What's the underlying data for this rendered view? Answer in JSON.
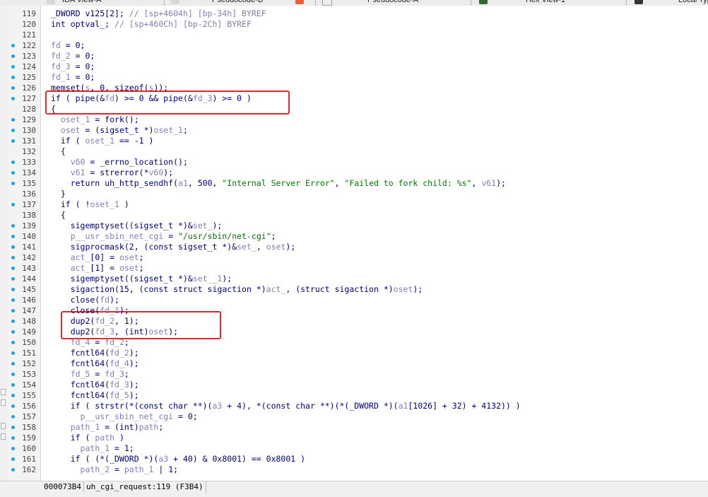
{
  "tabs": [
    {
      "label": "IDA View-A",
      "icon_color": "#e6e6e6"
    },
    {
      "label": "Pseudocode-B",
      "icon_color": "#e6e6e6"
    },
    {
      "label": "Pseudocode-A",
      "icon_color": "#ffffff"
    },
    {
      "label": "Hex View-1",
      "icon_color": "#2f6b2f"
    },
    {
      "label": "Local Types",
      "icon_color": "#333333"
    }
  ],
  "accent": {
    "highlight_box": "#e02a2a",
    "breakpoint_dot": "#1fa0e8",
    "tab_close": "#e8603a"
  },
  "lines": [
    {
      "num": "119",
      "dot": false,
      "code": "_DWORD v125[2]; // [sp+4604h] [bp-34h] BYREF"
    },
    {
      "num": "120",
      "dot": false,
      "code": "int optval_; // [sp+460Ch] [bp-2Ch] BYREF"
    },
    {
      "num": "121",
      "dot": false,
      "code": ""
    },
    {
      "num": "122",
      "dot": true,
      "code": "fd = 0;"
    },
    {
      "num": "123",
      "dot": true,
      "code": "fd_2 = 0;"
    },
    {
      "num": "124",
      "dot": true,
      "code": "fd_3 = 0;"
    },
    {
      "num": "125",
      "dot": true,
      "code": "fd_1 = 0;"
    },
    {
      "num": "126",
      "dot": true,
      "code": "memset(s, 0, sizeof(s));"
    },
    {
      "num": "127",
      "dot": true,
      "code": "if ( pipe(&fd) >= 0 && pipe(&fd_3) >= 0 )"
    },
    {
      "num": "128",
      "dot": false,
      "code": "{"
    },
    {
      "num": "129",
      "dot": true,
      "code": "  oset_1 = fork();"
    },
    {
      "num": "130",
      "dot": true,
      "code": "  oset = (sigset_t *)oset_1;"
    },
    {
      "num": "131",
      "dot": true,
      "code": "  if ( oset_1 == -1 )"
    },
    {
      "num": "132",
      "dot": false,
      "code": "  {"
    },
    {
      "num": "133",
      "dot": true,
      "code": "    v60 = _errno_location();"
    },
    {
      "num": "134",
      "dot": true,
      "code": "    v61 = strerror(*v60);"
    },
    {
      "num": "135",
      "dot": true,
      "code": "    return uh_http_sendhf(a1, 500, \"Internal Server Error\", \"Failed to fork child: %s\", v61);"
    },
    {
      "num": "136",
      "dot": false,
      "code": "  }"
    },
    {
      "num": "137",
      "dot": true,
      "code": "  if ( !oset_1 )"
    },
    {
      "num": "138",
      "dot": false,
      "code": "  {"
    },
    {
      "num": "139",
      "dot": true,
      "code": "    sigemptyset((sigset_t *)&set_);"
    },
    {
      "num": "140",
      "dot": true,
      "code": "    p__usr_sbin_net_cgi = \"/usr/sbin/net-cgi\";"
    },
    {
      "num": "141",
      "dot": true,
      "code": "    sigprocmask(2, (const sigset_t *)&set_, oset);"
    },
    {
      "num": "142",
      "dot": true,
      "code": "    act_[0] = oset;"
    },
    {
      "num": "143",
      "dot": true,
      "code": "    act_[1] = oset;"
    },
    {
      "num": "144",
      "dot": true,
      "code": "    sigemptyset((sigset_t *)&set__1);"
    },
    {
      "num": "145",
      "dot": true,
      "code": "    sigaction(15, (const struct sigaction *)act_, (struct sigaction *)oset);"
    },
    {
      "num": "146",
      "dot": true,
      "code": "    close(fd);"
    },
    {
      "num": "147",
      "dot": true,
      "code": "    close(fd_1);"
    },
    {
      "num": "148",
      "dot": true,
      "code": "    dup2(fd_2, 1);"
    },
    {
      "num": "149",
      "dot": true,
      "code": "    dup2(fd_3, (int)oset);"
    },
    {
      "num": "150",
      "dot": true,
      "code": "    fd_4 = fd_2;"
    },
    {
      "num": "151",
      "dot": true,
      "code": "    fcntl64(fd_2);"
    },
    {
      "num": "152",
      "dot": true,
      "code": "    fcntl64(fd_4);"
    },
    {
      "num": "153",
      "dot": true,
      "code": "    fd_5 = fd_3;"
    },
    {
      "num": "154",
      "dot": true,
      "code": "    fcntl64(fd_3);"
    },
    {
      "num": "155",
      "dot": true,
      "code": "    fcntl64(fd_5);"
    },
    {
      "num": "156",
      "dot": true,
      "code": "    if ( strstr(*(const char **)(a3 + 4), *(const char **)(*(_DWORD *)(a1[1026] + 32) + 4132)) )"
    },
    {
      "num": "157",
      "dot": true,
      "code": "      p__usr_sbin_net_cgi = 0;"
    },
    {
      "num": "158",
      "dot": true,
      "code": "    path_1 = (int)path;"
    },
    {
      "num": "159",
      "dot": true,
      "code": "    if ( path )"
    },
    {
      "num": "160",
      "dot": true,
      "code": "      path_1 = 1;"
    },
    {
      "num": "161",
      "dot": true,
      "code": "    if ( (*(_DWORD *)(a3 + 40) & 0x8001) == 0x8001 )"
    },
    {
      "num": "162",
      "dot": true,
      "code": "      path_2 = path_1 | 1;"
    }
  ],
  "status": {
    "address": "000073B4",
    "location": "uh_cgi_request:119 (F3B4)"
  }
}
